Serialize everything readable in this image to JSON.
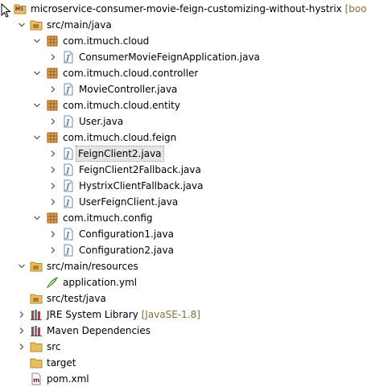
{
  "colors": {
    "package": "#9a5b1a",
    "folder": "#e8c15d",
    "java_file": "#5b7fb5",
    "decoration": "#8a6d3b",
    "selection": "#e5e5e5",
    "toggle": "#606060"
  },
  "tree": [
    {
      "label": "microservice-consumer-movie-feign-customizing-without-hystrix",
      "decoration": "[boot]",
      "icon": "maven-project-icon",
      "expanded": true
    },
    {
      "label": "src/main/java",
      "icon": "source-folder-icon",
      "expanded": true
    },
    {
      "label": "com.itmuch.cloud",
      "icon": "package-icon",
      "expanded": true
    },
    {
      "label": "ConsumerMovieFeignApplication.java",
      "icon": "java-file-icon",
      "expanded": false
    },
    {
      "label": "com.itmuch.cloud.controller",
      "icon": "package-icon",
      "expanded": true
    },
    {
      "label": "MovieController.java",
      "icon": "java-file-icon",
      "expanded": false
    },
    {
      "label": "com.itmuch.cloud.entity",
      "icon": "package-icon",
      "expanded": true
    },
    {
      "label": "User.java",
      "icon": "java-file-icon",
      "expanded": false
    },
    {
      "label": "com.itmuch.cloud.feign",
      "icon": "package-icon",
      "expanded": true
    },
    {
      "label": "FeignClient2.java",
      "icon": "java-file-icon",
      "expanded": false,
      "selected": true
    },
    {
      "label": "FeignClient2Fallback.java",
      "icon": "java-file-icon",
      "expanded": false
    },
    {
      "label": "HystrixClientFallback.java",
      "icon": "java-file-icon",
      "expanded": false
    },
    {
      "label": "UserFeignClient.java",
      "icon": "java-file-icon",
      "expanded": false
    },
    {
      "label": "com.itmuch.config",
      "icon": "package-icon",
      "expanded": true
    },
    {
      "label": "Configuration1.java",
      "icon": "java-file-icon",
      "expanded": false
    },
    {
      "label": "Configuration2.java",
      "icon": "java-file-icon",
      "expanded": false
    },
    {
      "label": "src/main/resources",
      "icon": "source-folder-icon",
      "expanded": true
    },
    {
      "label": "application.yml",
      "icon": "yml-file-icon"
    },
    {
      "label": "src/test/java",
      "icon": "source-folder-icon"
    },
    {
      "label": "JRE System Library",
      "decoration": "[JavaSE-1.8]",
      "icon": "library-icon",
      "expanded": false
    },
    {
      "label": "Maven Dependencies",
      "icon": "library-icon",
      "expanded": false
    },
    {
      "label": "src",
      "icon": "folder-icon",
      "expanded": false
    },
    {
      "label": "target",
      "icon": "folder-icon"
    },
    {
      "label": "pom.xml",
      "icon": "maven-pom-icon"
    }
  ]
}
